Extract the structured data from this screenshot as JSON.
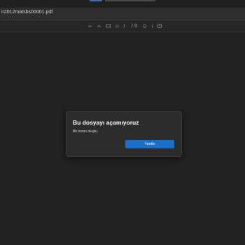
{
  "browser": {
    "address": "n2012matsbs00001.pdf"
  },
  "toolbar": {
    "page_separator": "/ 0",
    "icons": [
      "chevron-down-icon",
      "chevron-up-icon",
      "minus-icon",
      "fit-page-icon",
      "page-input",
      "rotate-icon",
      "zoom-in-icon",
      "settings-icon"
    ]
  },
  "dialog": {
    "title": "Bu dosyayı açamıyoruz",
    "message": "Bir sorun oluştu.",
    "button_label": "Yenile"
  },
  "colors": {
    "background": "#222222",
    "dialog": "#2c2c2c",
    "accent": "#1a70c8"
  }
}
